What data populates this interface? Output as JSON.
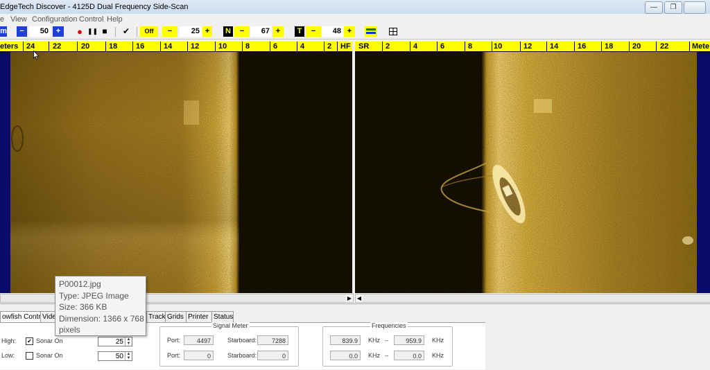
{
  "window": {
    "title": "EdgeTech  Discover - 4125D  Dual Frequency Side-Scan",
    "minimize": "—",
    "restore": "❐"
  },
  "menu": [
    "e",
    "View",
    "Configuration",
    "Control",
    "Help"
  ],
  "toolbar": {
    "left_tab": "m",
    "gain_minus": "−",
    "gain_value": "50",
    "gain_plus": "+",
    "record": "●",
    "pause": "❚❚",
    "stop": "■",
    "check": "✔",
    "off_label": "Off",
    "tvg_minus": "−",
    "tvg_value": "25",
    "tvg_plus": "+",
    "n_label": "N",
    "n_minus": "−",
    "n_value": "67",
    "n_plus": "+",
    "t_label": "T",
    "t_minus": "−",
    "t_value": "48",
    "t_plus": "+"
  },
  "left_ruler": {
    "unit": "eters",
    "ticks": [
      "24",
      "22",
      "20",
      "18",
      "16",
      "14",
      "12",
      "10",
      "8",
      "6",
      "4",
      "2"
    ],
    "freq": "HF"
  },
  "right_ruler": {
    "freq": "SR",
    "ticks": [
      "2",
      "4",
      "6",
      "8",
      "10",
      "12",
      "14",
      "16",
      "18",
      "20",
      "22"
    ],
    "unit": "Mete"
  },
  "tabs": [
    "owfish Control",
    "Vide",
    "Track",
    "Grids",
    "Printer",
    "Status"
  ],
  "towfish": {
    "high_label": "High:",
    "low_label": "Low:",
    "sonar_on_label": "Sonar On",
    "high_checked": true,
    "low_checked": false,
    "high_value": "25",
    "low_value": "50"
  },
  "signal_meter": {
    "title": "Signal Meter",
    "port_label": "Port:",
    "starboard_label": "Starboard:",
    "port_high": "4497",
    "starboard_high": "7288",
    "port_low": "0",
    "starboard_low": "0"
  },
  "frequencies": {
    "title": "Frequencies",
    "row1_a": "839.9",
    "row1_b": "959.9",
    "row2_a": "0.0",
    "row2_b": "0.0",
    "unit": "KHz",
    "dash": "–"
  },
  "tooltip": {
    "name": "P00012.jpg",
    "type": "Type: JPEG Image",
    "size": "Size: 366 KB",
    "dimension": "Dimension: 1366 x 768",
    "dimension_cont": "pixels"
  },
  "colors": {
    "sonar_bright": "#c8a032",
    "water_column": "#0d0a02",
    "ruler": "#ffff00",
    "toolbar_blue": "#1f3fd8",
    "edge_navy": "#0a0a6a"
  }
}
